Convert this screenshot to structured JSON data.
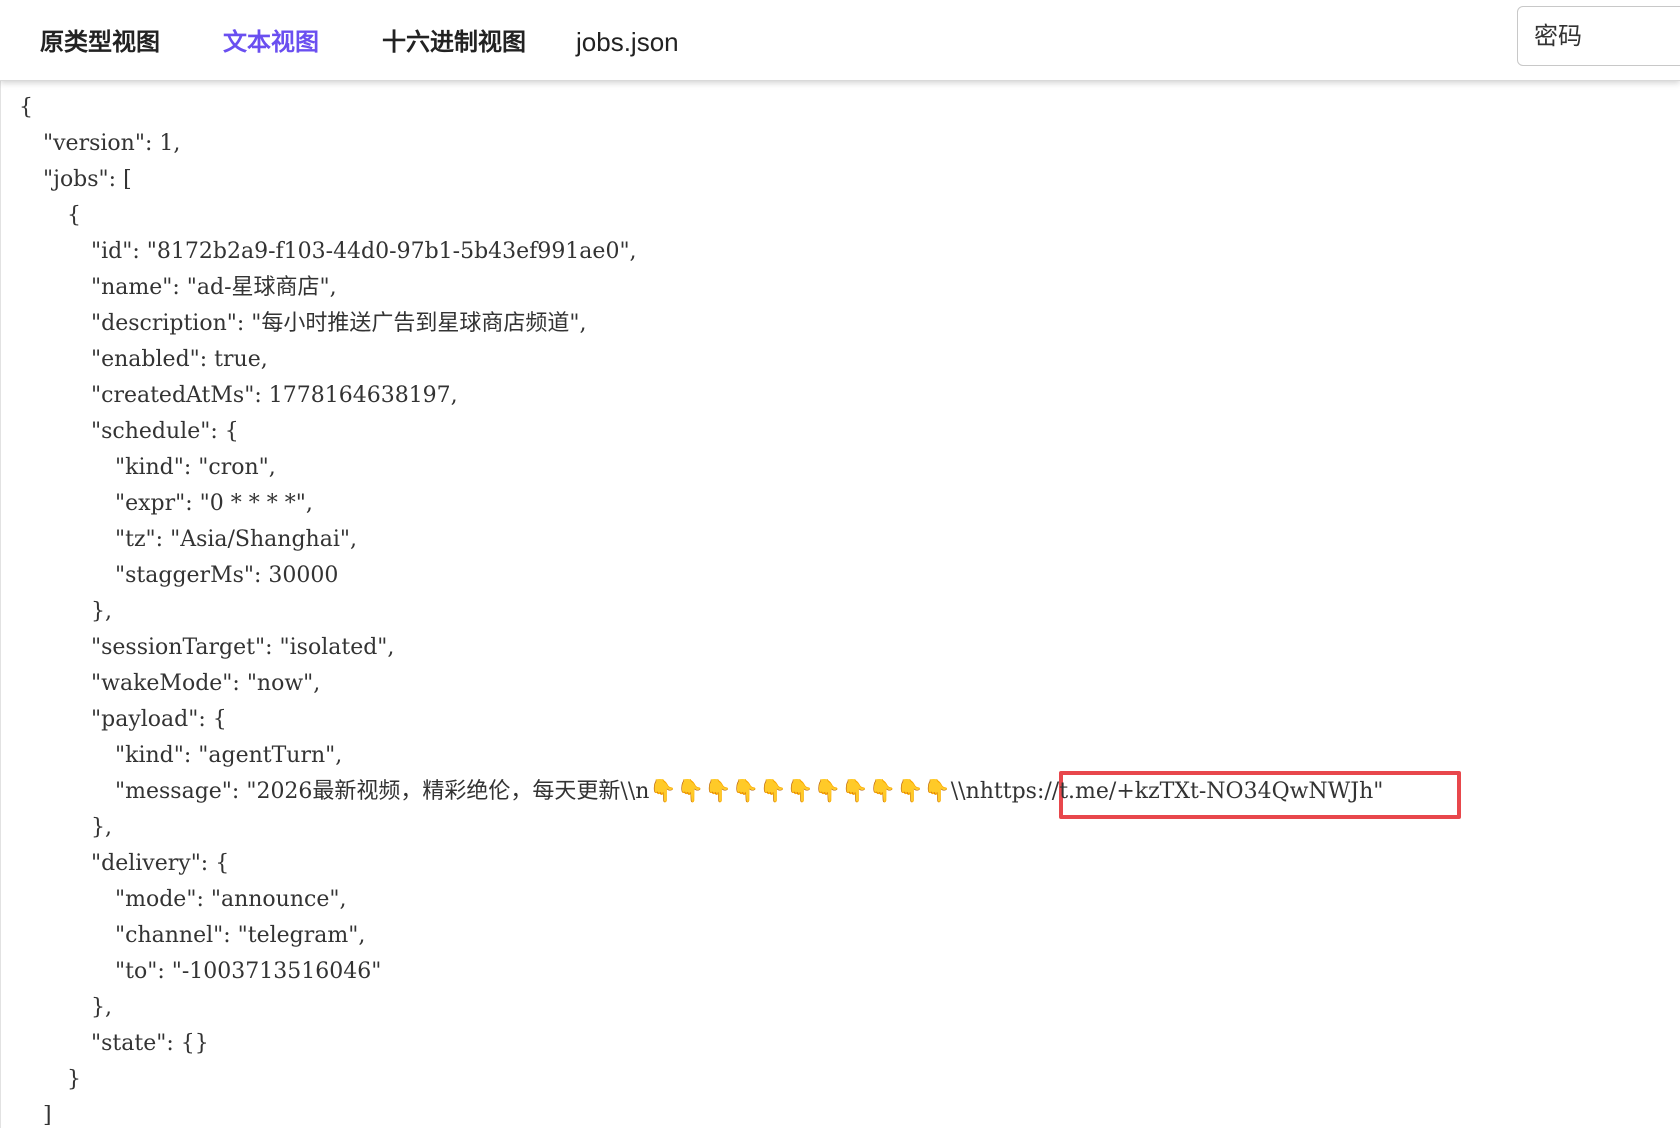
{
  "tabs": [
    {
      "label": "原类型视图",
      "active": false
    },
    {
      "label": "文本视图",
      "active": true
    },
    {
      "label": "十六进制视图",
      "active": false
    }
  ],
  "file_name": "jobs.json",
  "password_placeholder": "密码",
  "colors": {
    "accent": "#6a4ff0",
    "highlight": "#e8474c",
    "text": "#333333"
  },
  "highlighted_text": "nhttps://t.me/+kzTXt-NO34QwNWJh\"",
  "code_lines": [
    {
      "indent": 0,
      "text": "{"
    },
    {
      "indent": 1,
      "text": "\"version\": 1,"
    },
    {
      "indent": 1,
      "text": "\"jobs\": ["
    },
    {
      "indent": 2,
      "text": "{"
    },
    {
      "indent": 3,
      "text": "\"id\": \"8172b2a9-f103-44d0-97b1-5b43ef991ae0\","
    },
    {
      "indent": 3,
      "text": "\"name\": \"ad-星球商店\","
    },
    {
      "indent": 3,
      "text": "\"description\": \"每小时推送广告到星球商店频道\","
    },
    {
      "indent": 3,
      "text": "\"enabled\": true,"
    },
    {
      "indent": 3,
      "text": "\"createdAtMs\": 1778164638197,"
    },
    {
      "indent": 3,
      "text": "\"schedule\": {"
    },
    {
      "indent": 4,
      "text": "\"kind\": \"cron\","
    },
    {
      "indent": 4,
      "text": "\"expr\": \"0 * * * *\","
    },
    {
      "indent": 4,
      "text": "\"tz\": \"Asia/Shanghai\","
    },
    {
      "indent": 4,
      "text": "\"staggerMs\": 30000"
    },
    {
      "indent": 3,
      "text": "},"
    },
    {
      "indent": 3,
      "text": "\"sessionTarget\": \"isolated\","
    },
    {
      "indent": 3,
      "text": "\"wakeMode\": \"now\","
    },
    {
      "indent": 3,
      "text": "\"payload\": {"
    },
    {
      "indent": 4,
      "text": "\"kind\": \"agentTurn\","
    },
    {
      "indent": 4,
      "text": "\"message\": \"2026最新视频，精彩绝伦，每天更新\\\\n👇👇👇👇👇👇👇👇👇👇👇\\\\nhttps://t.me/+kzTXt-NO34QwNWJh\""
    },
    {
      "indent": 3,
      "text": "},"
    },
    {
      "indent": 3,
      "text": "\"delivery\": {"
    },
    {
      "indent": 4,
      "text": "\"mode\": \"announce\","
    },
    {
      "indent": 4,
      "text": "\"channel\": \"telegram\","
    },
    {
      "indent": 4,
      "text": "\"to\": \"-1003713516046\""
    },
    {
      "indent": 3,
      "text": "},"
    },
    {
      "indent": 3,
      "text": "\"state\": {}"
    },
    {
      "indent": 2,
      "text": "}"
    },
    {
      "indent": 1,
      "text": "]"
    }
  ]
}
